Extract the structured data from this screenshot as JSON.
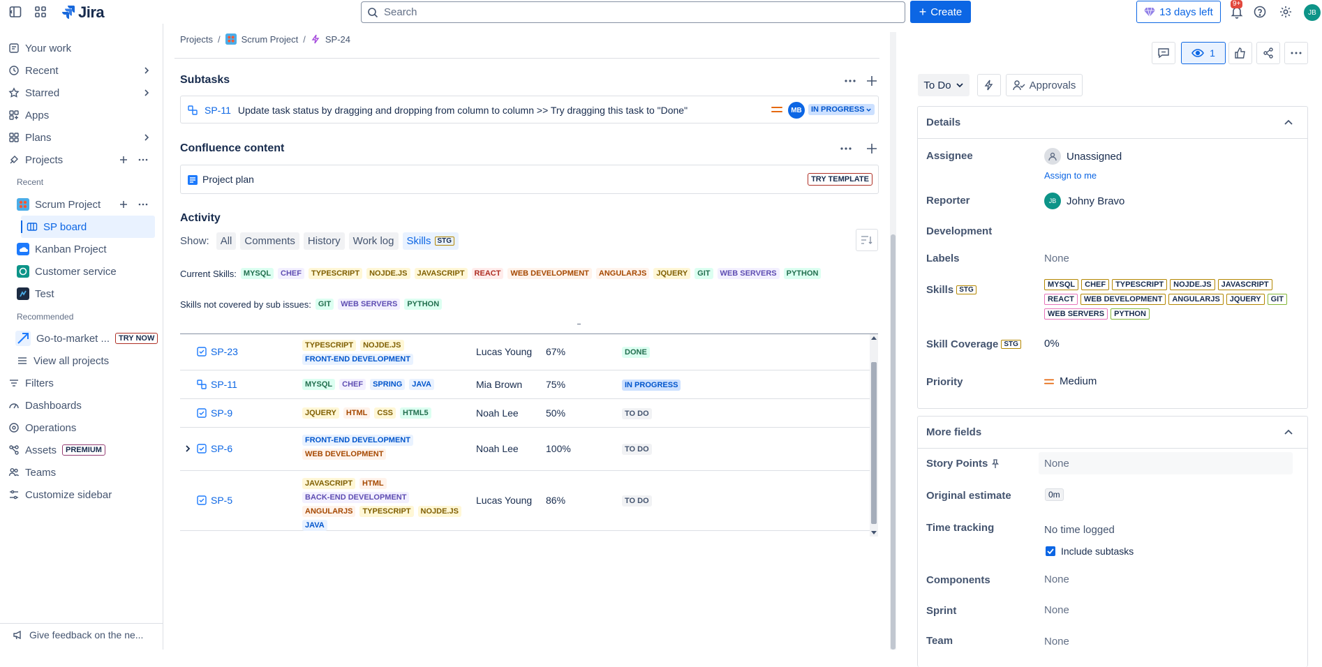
{
  "topnav": {
    "app_name": "Jira",
    "search_placeholder": "Search",
    "create_label": "Create",
    "trial_label": "13 days left",
    "notifications_badge": "9+",
    "user_initials": "JB"
  },
  "sidebar": {
    "your_work": "Your work",
    "recent": "Recent",
    "starred": "Starred",
    "apps": "Apps",
    "plans": "Plans",
    "projects": "Projects",
    "recent_section": "Recent",
    "scrum_project": "Scrum Project",
    "sp_board": "SP board",
    "kanban_project": "Kanban Project",
    "customer_service": "Customer service",
    "test": "Test",
    "recommended_section": "Recommended",
    "go_to_market": "Go-to-market ...",
    "try_now": "TRY NOW",
    "view_all_projects": "View all projects",
    "filters": "Filters",
    "dashboards": "Dashboards",
    "operations": "Operations",
    "assets": "Assets",
    "premium": "PREMIUM",
    "teams": "Teams",
    "customize_sidebar": "Customize sidebar",
    "feedback": "Give feedback on the ne..."
  },
  "breadcrumb": {
    "projects": "Projects",
    "project": "Scrum Project",
    "issue": "SP-24"
  },
  "subtasks": {
    "heading": "Subtasks",
    "items": [
      {
        "key": "SP-11",
        "summary": "Update task status by dragging and dropping from column to column >> Try dragging this task to \"Done\"",
        "assignee_initials": "MB",
        "status": "IN PROGRESS"
      }
    ]
  },
  "confluence": {
    "heading": "Confluence content",
    "page_title": "Project plan",
    "try_template": "TRY TEMPLATE"
  },
  "activity": {
    "heading": "Activity",
    "show_label": "Show:",
    "filters": [
      "All",
      "Comments",
      "History",
      "Work log",
      "Skills"
    ],
    "stg_badge": "STG",
    "current_skills_label": "Current Skills:",
    "current_skills": [
      {
        "name": "MYSQL",
        "color": "green"
      },
      {
        "name": "CHEF",
        "color": "purple"
      },
      {
        "name": "TYPESCRIPT",
        "color": "yellow"
      },
      {
        "name": "NOJDE.JS",
        "color": "yellow"
      },
      {
        "name": "JAVASCRIPT",
        "color": "yellow"
      },
      {
        "name": "REACT",
        "color": "red"
      },
      {
        "name": "WEB DEVELOPMENT",
        "color": "orange"
      },
      {
        "name": "ANGULARJS",
        "color": "orange"
      },
      {
        "name": "JQUERY",
        "color": "yellow"
      },
      {
        "name": "GIT",
        "color": "green"
      },
      {
        "name": "WEB SERVERS",
        "color": "purple"
      },
      {
        "name": "PYTHON",
        "color": "green"
      }
    ],
    "uncovered_label": "Skills not covered by sub issues:",
    "uncovered_skills": [
      {
        "name": "GIT",
        "color": "green"
      },
      {
        "name": "WEB SERVERS",
        "color": "purple"
      },
      {
        "name": "PYTHON",
        "color": "green"
      }
    ],
    "table_rows": [
      {
        "key": "SP-23",
        "type": "task",
        "skills": [
          {
            "name": "TYPESCRIPT",
            "color": "yellow"
          },
          {
            "name": "NOJDE.JS",
            "color": "yellow"
          },
          {
            "name": "FRONT-END DEVELOPMENT",
            "color": "blue"
          }
        ],
        "assignee": "Lucas Young",
        "pct": "67%",
        "status": "DONE",
        "status_kind": "done"
      },
      {
        "key": "SP-11",
        "type": "subtask",
        "skills": [
          {
            "name": "MYSQL",
            "color": "green"
          },
          {
            "name": "CHEF",
            "color": "purple"
          },
          {
            "name": "SPRING",
            "color": "blue"
          },
          {
            "name": "JAVA",
            "color": "blue"
          }
        ],
        "assignee": "Mia Brown",
        "pct": "75%",
        "status": "IN PROGRESS",
        "status_kind": "progress"
      },
      {
        "key": "SP-9",
        "type": "task",
        "skills": [
          {
            "name": "JQUERY",
            "color": "yellow"
          },
          {
            "name": "HTML",
            "color": "orange"
          },
          {
            "name": "CSS",
            "color": "yellow"
          },
          {
            "name": "HTML5",
            "color": "green"
          }
        ],
        "assignee": "Noah Lee",
        "pct": "50%",
        "status": "TO DO",
        "status_kind": "todo"
      },
      {
        "key": "SP-6",
        "type": "task",
        "expandable": true,
        "skills": [
          {
            "name": "FRONT-END DEVELOPMENT",
            "color": "blue"
          },
          {
            "name": "WEB DEVELOPMENT",
            "color": "orange"
          }
        ],
        "assignee": "Noah Lee",
        "pct": "100%",
        "status": "TO DO",
        "status_kind": "todo"
      },
      {
        "key": "SP-5",
        "type": "task",
        "skills": [
          {
            "name": "JAVASCRIPT",
            "color": "yellow"
          },
          {
            "name": "HTML",
            "color": "orange"
          },
          {
            "name": "BACK-END DEVELOPMENT",
            "color": "purple"
          },
          {
            "name": "ANGULARJS",
            "color": "orange"
          },
          {
            "name": "TYPESCRIPT",
            "color": "yellow"
          },
          {
            "name": "NOJDE.JS",
            "color": "yellow"
          },
          {
            "name": "JAVA",
            "color": "blue"
          }
        ],
        "assignee": "Lucas Young",
        "pct": "86%",
        "status": "TO DO",
        "status_kind": "todo"
      }
    ]
  },
  "right": {
    "watch_count": "1",
    "status_label": "To Do",
    "approvals_label": "Approvals",
    "details_heading": "Details",
    "assignee_label": "Assignee",
    "assignee_value": "Unassigned",
    "assign_to_me": "Assign to me",
    "reporter_label": "Reporter",
    "reporter_initials": "JB",
    "reporter_value": "Johny Bravo",
    "development_label": "Development",
    "labels_label": "Labels",
    "labels_value": "None",
    "skills_label": "Skills",
    "stg_badge": "STG",
    "skills": [
      {
        "name": "MYSQL",
        "color": "yellow"
      },
      {
        "name": "CHEF",
        "color": "yellow"
      },
      {
        "name": "TYPESCRIPT",
        "color": "yellow"
      },
      {
        "name": "NOJDE.JS",
        "color": "yellow"
      },
      {
        "name": "JAVASCRIPT",
        "color": "yellow"
      },
      {
        "name": "REACT",
        "color": "magenta"
      },
      {
        "name": "WEB DEVELOPMENT",
        "color": "yellow"
      },
      {
        "name": "ANGULARJS",
        "color": "yellow"
      },
      {
        "name": "JQUERY",
        "color": "yellow"
      },
      {
        "name": "GIT",
        "color": "lime"
      },
      {
        "name": "WEB SERVERS",
        "color": "magenta"
      },
      {
        "name": "PYTHON",
        "color": "lime"
      }
    ],
    "coverage_label": "Skill Coverage",
    "coverage_value": "0%",
    "priority_label": "Priority",
    "priority_value": "Medium",
    "more_fields_heading": "More fields",
    "story_points_label": "Story Points",
    "story_points_value": "None",
    "original_estimate_label": "Original estimate",
    "original_estimate_value": "0m",
    "time_tracking_label": "Time tracking",
    "time_tracking_value": "No time logged",
    "include_subtasks": "Include subtasks",
    "components_label": "Components",
    "components_value": "None",
    "sprint_label": "Sprint",
    "sprint_value": "None",
    "team_label": "Team",
    "team_value": "None"
  }
}
